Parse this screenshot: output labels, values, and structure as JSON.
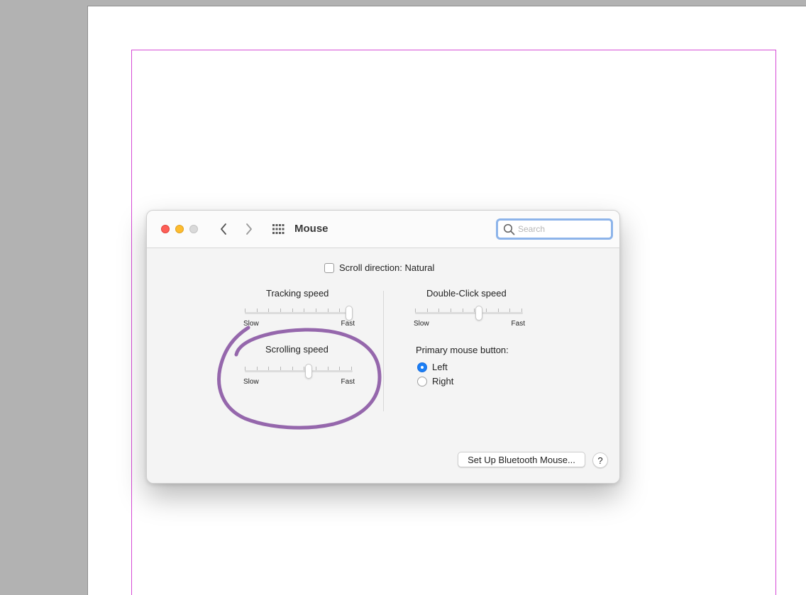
{
  "window": {
    "title": "Mouse",
    "search_placeholder": "Search"
  },
  "scroll_direction": {
    "label": "Scroll direction: Natural",
    "checked": false
  },
  "tracking_speed": {
    "title": "Tracking speed",
    "min_label": "Slow",
    "max_label": "Fast",
    "value": 1.0
  },
  "scrolling_speed": {
    "title": "Scrolling speed",
    "min_label": "Slow",
    "max_label": "Fast",
    "value": 0.6
  },
  "double_click_speed": {
    "title": "Double-Click speed",
    "min_label": "Slow",
    "max_label": "Fast",
    "value": 0.6
  },
  "primary_button": {
    "title": "Primary mouse button:",
    "options": [
      {
        "label": "Left",
        "selected": true
      },
      {
        "label": "Right",
        "selected": false
      }
    ]
  },
  "buttons": {
    "bluetooth": "Set Up Bluetooth Mouse...",
    "help": "?"
  },
  "colors": {
    "accent": "#1a7ef5",
    "annotation": "#8c5aa5",
    "margin_guide": "#d64ad6"
  }
}
